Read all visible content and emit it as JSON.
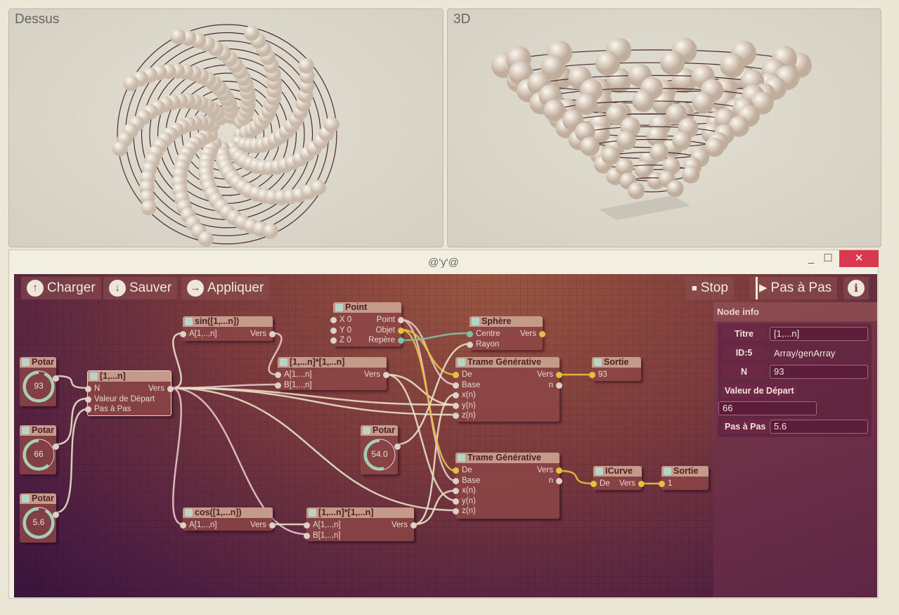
{
  "viewports": [
    {
      "label": "Dessus"
    },
    {
      "label": "3D"
    }
  ],
  "window": {
    "title": "@'y'@",
    "minimize": "_",
    "maximize": "☐",
    "close": "✕"
  },
  "toolbar": {
    "left": [
      {
        "label": "Charger",
        "icon": "arrow-up-circle-icon",
        "glyph": "↑"
      },
      {
        "label": "Sauver",
        "icon": "arrow-down-circle-icon",
        "glyph": "↓"
      },
      {
        "label": "Appliquer",
        "icon": "arrow-right-circle-icon",
        "glyph": "→"
      }
    ],
    "stop": {
      "label": "Stop",
      "glyph": "■"
    },
    "step": {
      "label": "Pas à Pas",
      "glyph": "▶"
    },
    "info": {
      "glyph": "i"
    }
  },
  "colors": {
    "accent": "#e8c040",
    "wire": "#e6e0c4",
    "wire_pink": "#e6c8c8",
    "wire_teal": "#7ec0a8",
    "close": "#d8394f"
  },
  "nodes": {
    "potar93": {
      "title": "Potar",
      "value": "93",
      "level": 0.93
    },
    "potar66": {
      "title": "Potar",
      "value": "66",
      "level": 0.62
    },
    "potar56": {
      "title": "Potar",
      "value": "5.6",
      "level": 0.92
    },
    "potar54": {
      "title": "Potar",
      "value": "54.0",
      "level": 0.55
    },
    "gen": {
      "title": "[1,...n]",
      "rows": [
        {
          "in": "N",
          "out": "Vers"
        },
        {
          "in": "Valeur de Départ"
        },
        {
          "in": "Pas à Pas"
        }
      ]
    },
    "sin": {
      "title": "sin([1,...n])",
      "rows": [
        {
          "in": "A[1,..,n]",
          "out": "Vers"
        }
      ]
    },
    "mult1": {
      "title": "[1,...n]*[1,...n]",
      "rows": [
        {
          "in": "A[1,..,n]",
          "out": "Vers"
        },
        {
          "in": "B[1,..,n]"
        }
      ]
    },
    "point": {
      "title": "Point",
      "rows": [
        {
          "in": "X  0",
          "out": "Point"
        },
        {
          "in": "Y  0",
          "out": "Objet",
          "out_type": "object"
        },
        {
          "in": "Z  0",
          "out": "Repère",
          "out_type": "frame"
        }
      ]
    },
    "sphere": {
      "title": "Sphère",
      "rows": [
        {
          "in": "Centre",
          "in_type": "frame",
          "out": "Vers",
          "out_type": "object"
        },
        {
          "in": "Rayon"
        }
      ]
    },
    "trame1": {
      "title": "Trame Générative",
      "rows": [
        {
          "in": "De",
          "in_type": "object",
          "out": "Vers",
          "out_type": "object"
        },
        {
          "in": "Base",
          "out": "n"
        },
        {
          "in": "x(n)"
        },
        {
          "in": "y(n)"
        },
        {
          "in": "z(n)"
        }
      ]
    },
    "sortie1": {
      "title": "Sortie",
      "rows": [
        {
          "in": "93",
          "in_type": "object"
        }
      ]
    },
    "trame2": {
      "title": "Trame Générative",
      "rows": [
        {
          "in": "De",
          "in_type": "object",
          "out": "Vers",
          "out_type": "object"
        },
        {
          "in": "Base",
          "out": "n"
        },
        {
          "in": "x(n)"
        },
        {
          "in": "y(n)"
        },
        {
          "in": "z(n)"
        }
      ]
    },
    "icurve": {
      "title": "ICurve",
      "rows": [
        {
          "in": "De",
          "in_type": "object",
          "out": "Vers",
          "out_type": "object"
        }
      ]
    },
    "sortie2": {
      "title": "Sortie",
      "rows": [
        {
          "in": "1",
          "in_type": "object"
        }
      ]
    },
    "cos": {
      "title": "cos([1,...n])",
      "rows": [
        {
          "in": "A[1,..,n]",
          "out": "Vers"
        }
      ]
    },
    "mult2": {
      "title": "[1,...n]*[1,...n]",
      "rows": [
        {
          "in": "A[1,..,n]",
          "out": "Vers"
        },
        {
          "in": "B[1,..,n]"
        }
      ]
    }
  },
  "node_info": {
    "heading": "Node info",
    "titre_label": "Titre",
    "titre_value": "[1,...n]",
    "id_label": "ID:5",
    "type": "Array/genArray",
    "n_label": "N",
    "n_value": "93",
    "start_label": "Valeur de Départ",
    "start_value": "66",
    "step_label": "Pas à Pas",
    "step_value": "5.6"
  }
}
